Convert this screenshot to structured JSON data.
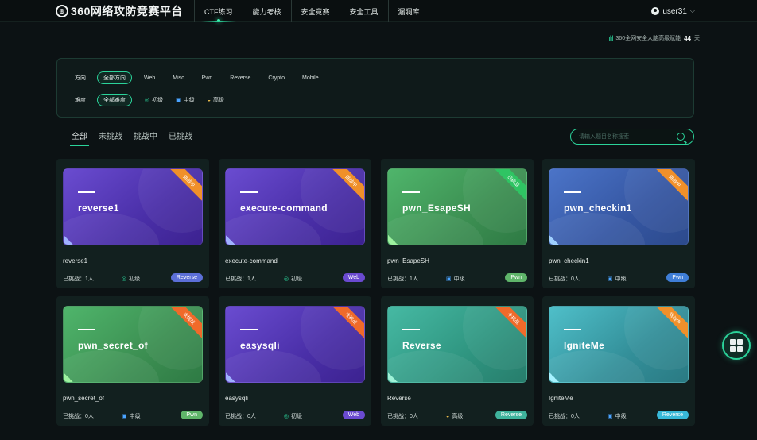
{
  "header": {
    "logo_text": "360网络攻防竞赛平台",
    "nav": [
      {
        "label": "CTF练习",
        "active": true
      },
      {
        "label": "能力考核",
        "active": false
      },
      {
        "label": "安全竞赛",
        "active": false
      },
      {
        "label": "安全工具",
        "active": false
      },
      {
        "label": "漏洞库",
        "active": false
      }
    ],
    "user": "user31"
  },
  "banner": {
    "text": "360全网安全大脑高级赋能",
    "days": "44",
    "unit": "天"
  },
  "filters": {
    "direction_label": "方向",
    "directions": [
      "全部方向",
      "Web",
      "Misc",
      "Pwn",
      "Reverse",
      "Crypto",
      "Mobile"
    ],
    "difficulty_label": "难度",
    "difficulties": [
      "全部难度",
      "初级",
      "中级",
      "高级"
    ]
  },
  "tabs": [
    "全部",
    "未挑战",
    "挑战中",
    "已挑战"
  ],
  "search": {
    "placeholder": "请输入题目名称搜索"
  },
  "cards": [
    {
      "title": "reverse1",
      "name": "reverse1",
      "status": "挑战中",
      "challenged": "已挑战：1人",
      "level": "初级",
      "category": "Reverse"
    },
    {
      "title": "execute-command",
      "name": "execute-command",
      "status": "挑战中",
      "challenged": "已挑战：1人",
      "level": "初级",
      "category": "Web"
    },
    {
      "title": "pwn_EsapeSH",
      "name": "pwn_EsapeSH",
      "status": "已挑战",
      "challenged": "已挑战：1人",
      "level": "中级",
      "category": "Pwn"
    },
    {
      "title": "pwn_checkin1",
      "name": "pwn_checkin1",
      "status": "挑战中",
      "challenged": "已挑战：0人",
      "level": "中级",
      "category": "Pwn"
    },
    {
      "title": "pwn_secret_of",
      "name": "pwn_secret_of",
      "status": "未挑战",
      "challenged": "已挑战：0人",
      "level": "中级",
      "category": "Pwn"
    },
    {
      "title": "easysqli",
      "name": "easysqli",
      "status": "未挑战",
      "challenged": "已挑战：0人",
      "level": "初级",
      "category": "Web"
    },
    {
      "title": "Reverse",
      "name": "Reverse",
      "status": "未挑战",
      "challenged": "已挑战：0人",
      "level": "高级",
      "category": "Reverse"
    },
    {
      "title": "IgniteMe",
      "name": "IgniteMe",
      "status": "挑战中",
      "challenged": "已挑战：0人",
      "level": "中级",
      "category": "Reverse"
    }
  ],
  "colors": {
    "accent": "#2bd39a",
    "background": "#0c1214"
  }
}
